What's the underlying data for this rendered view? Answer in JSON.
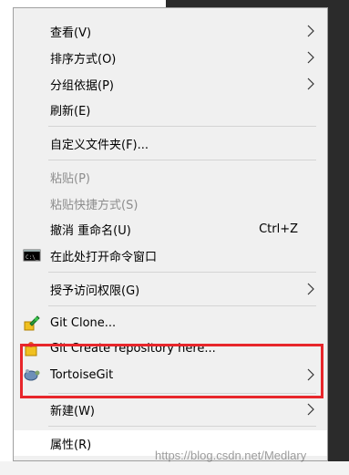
{
  "menu": {
    "items": [
      {
        "label": "查看(V)",
        "submenu": true
      },
      {
        "label": "排序方式(O)",
        "submenu": true
      },
      {
        "label": "分组依据(P)",
        "submenu": true
      },
      {
        "label": "刷新(E)"
      },
      {
        "label": "自定义文件夹(F)..."
      },
      {
        "label": "粘贴(P)",
        "disabled": true
      },
      {
        "label": "粘贴快捷方式(S)",
        "disabled": true
      },
      {
        "label": "撤消 重命名(U)",
        "shortcut": "Ctrl+Z"
      },
      {
        "label": "在此处打开命令窗口",
        "icon": "command-prompt-icon"
      },
      {
        "label": "授予访问权限(G)",
        "submenu": true
      },
      {
        "label": "Git Clone...",
        "icon": "git-clone-icon"
      },
      {
        "label": "Git Create repository here...",
        "icon": "git-create-repo-icon"
      },
      {
        "label": "TortoiseGit",
        "icon": "tortoisegit-icon",
        "submenu": true
      },
      {
        "label": "新建(W)",
        "submenu": true
      },
      {
        "label": "属性(R)"
      }
    ]
  },
  "watermark": "https://blog.csdn.net/Medlary",
  "colors": {
    "highlight": "#e8262b",
    "menu_bg": "#f0f0f0",
    "disabled_text": "#8d8d8d"
  }
}
